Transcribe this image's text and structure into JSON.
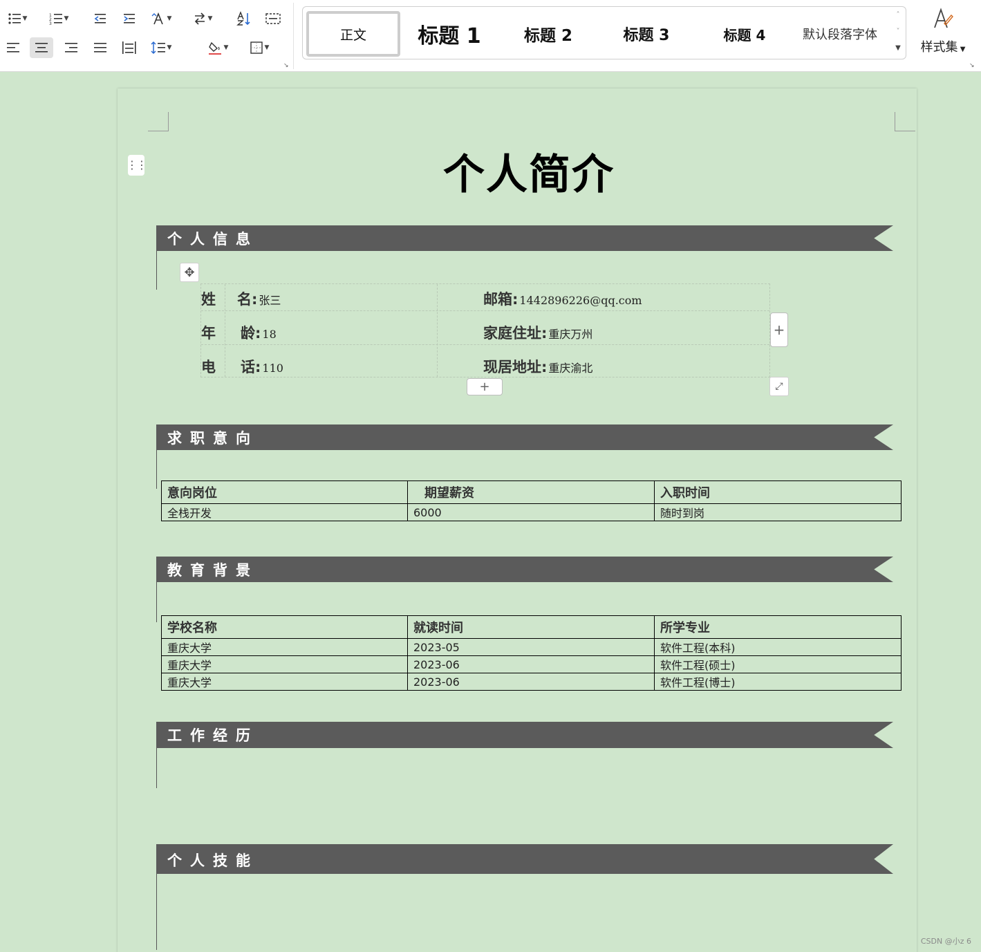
{
  "ribbon": {
    "styles": {
      "normal": "正文",
      "h1": "标题 1",
      "h2": "标题 2",
      "h3": "标题 3",
      "h4": "标题 4",
      "default_font": "默认段落字体"
    },
    "style_set_label": "样式集"
  },
  "document": {
    "title": "个人简介",
    "sections": {
      "personal": "个人信息",
      "intent": "求职意向",
      "education": "教育背景",
      "work": "工作经历",
      "skills": "个人技能"
    },
    "personal_info": {
      "name_k1": "姓",
      "name_k2": "名:",
      "name_v": "张三",
      "age_k1": "年",
      "age_k2": "龄:",
      "age_v": "18",
      "phone_k1": "电",
      "phone_k2": "话:",
      "phone_v": "110",
      "email_k": "邮箱:",
      "email_v": "1442896226@qq.com",
      "home_k": "家庭住址:",
      "home_v": "重庆万州",
      "current_k": "现居地址:",
      "current_v": "重庆渝北"
    },
    "intent_table": {
      "headers": [
        "意向岗位",
        "期望薪资",
        "入职时间"
      ],
      "rows": [
        [
          "全栈开发",
          "6000",
          "随时到岗"
        ]
      ]
    },
    "education_table": {
      "headers": [
        "学校名称",
        "就读时间",
        "所学专业"
      ],
      "rows": [
        [
          "重庆大学",
          "2023-05",
          "软件工程(本科)"
        ],
        [
          "重庆大学",
          "2023-06",
          "软件工程(硕士)"
        ],
        [
          "重庆大学",
          "2023-06",
          "软件工程(博士)"
        ]
      ]
    }
  },
  "watermark": "CSDN @小z 6",
  "colors": {
    "page_background": "#cfe6cc",
    "banner": "#5b5b5b"
  }
}
